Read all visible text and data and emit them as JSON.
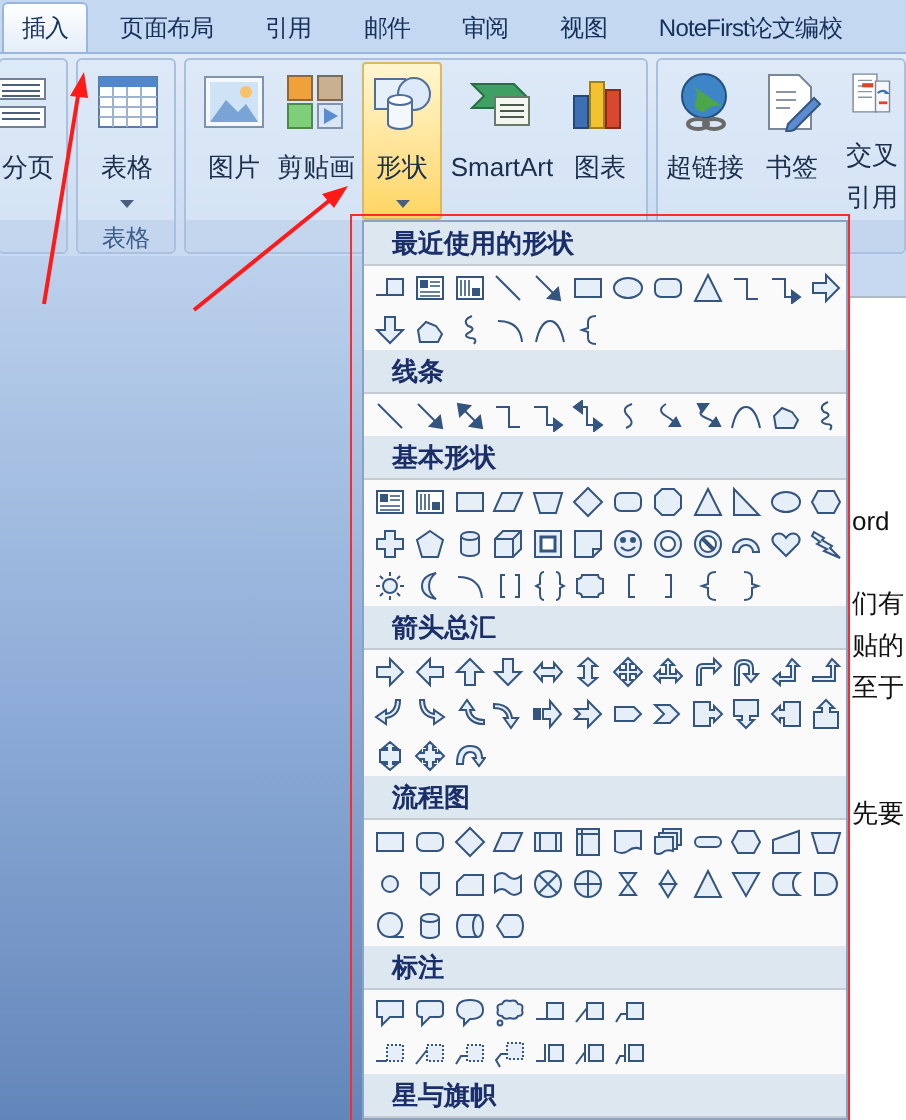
{
  "tabs": [
    {
      "label": "插入",
      "selected": true
    },
    {
      "label": "页面布局",
      "selected": false
    },
    {
      "label": "引用",
      "selected": false
    },
    {
      "label": "邮件",
      "selected": false
    },
    {
      "label": "审阅",
      "selected": false
    },
    {
      "label": "视图",
      "selected": false
    },
    {
      "label": "NoteFirst论文编校",
      "selected": false
    }
  ],
  "ribbon": {
    "groups": [
      {
        "buttons": [
          {
            "label": "分页",
            "kind": "page-break",
            "dropdown": false
          }
        ]
      },
      {
        "label": "表格",
        "buttons": [
          {
            "label": "表格",
            "kind": "table",
            "dropdown": true
          }
        ]
      },
      {
        "buttons": [
          {
            "label": "图片",
            "kind": "picture",
            "dropdown": false,
            "expanded": false
          },
          {
            "label": "剪贴画",
            "kind": "clip-art",
            "dropdown": false,
            "expanded": false
          },
          {
            "label": "形状",
            "kind": "shapes",
            "dropdown": true,
            "expanded": true
          },
          {
            "label": "SmartArt",
            "kind": "smartart",
            "dropdown": false,
            "expanded": false
          },
          {
            "label": "图表",
            "kind": "chart",
            "dropdown": false,
            "expanded": false
          }
        ]
      },
      {
        "buttons": [
          {
            "label": "超链接",
            "kind": "hyperlink",
            "dropdown": false
          },
          {
            "label": "书签",
            "kind": "bookmark",
            "dropdown": false
          },
          {
            "label": "交叉引用",
            "kind": "cross-reference",
            "dropdown": false
          }
        ]
      }
    ]
  },
  "shape_menu": {
    "sections": [
      {
        "title": "最近使用的形状",
        "rows": [
          [
            {
              "kind": "line-callout"
            },
            {
              "kind": "text-box"
            },
            {
              "kind": "vertical-text-box"
            },
            {
              "kind": "line"
            },
            {
              "kind": "arrow-line"
            },
            {
              "kind": "rect"
            },
            {
              "kind": "ellipse"
            },
            {
              "kind": "rounded-rect"
            },
            {
              "kind": "triangle"
            },
            {
              "kind": "elbow-line"
            },
            {
              "kind": "elbow-arrow"
            },
            {
              "kind": "right-arrow"
            }
          ],
          [
            {
              "kind": "down-arrow"
            },
            {
              "kind": "freeform"
            },
            {
              "kind": "scribble"
            },
            {
              "kind": "arc"
            },
            {
              "kind": "arch-curve"
            },
            {
              "kind": "left-brace"
            }
          ]
        ]
      },
      {
        "title": "线条",
        "rows": [
          [
            {
              "kind": "line"
            },
            {
              "kind": "arrow-line"
            },
            {
              "kind": "double-arrow-line"
            },
            {
              "kind": "elbow-line"
            },
            {
              "kind": "elbow-arrow"
            },
            {
              "kind": "elbow-double-arrow"
            },
            {
              "kind": "curved-line"
            },
            {
              "kind": "curved-arrow"
            },
            {
              "kind": "curved-double-arrow"
            },
            {
              "kind": "arch-curve"
            },
            {
              "kind": "freeform"
            },
            {
              "kind": "scribble"
            }
          ]
        ]
      },
      {
        "title": "基本形状",
        "rows": [
          [
            {
              "kind": "text-box"
            },
            {
              "kind": "vertical-text-box"
            },
            {
              "kind": "rect"
            },
            {
              "kind": "parallelogram"
            },
            {
              "kind": "trapezoid"
            },
            {
              "kind": "diamond"
            },
            {
              "kind": "rounded-rect"
            },
            {
              "kind": "octagon"
            },
            {
              "kind": "triangle"
            },
            {
              "kind": "right-triangle"
            },
            {
              "kind": "ellipse"
            },
            {
              "kind": "hexagon"
            }
          ],
          [
            {
              "kind": "cross"
            },
            {
              "kind": "pentagon"
            },
            {
              "kind": "cylinder"
            },
            {
              "kind": "cube"
            },
            {
              "kind": "frame"
            },
            {
              "kind": "folded-corner"
            },
            {
              "kind": "smiley"
            },
            {
              "kind": "donut"
            },
            {
              "kind": "no-symbol"
            },
            {
              "kind": "block-arc"
            },
            {
              "kind": "heart"
            },
            {
              "kind": "lightning"
            }
          ],
          [
            {
              "kind": "sun"
            },
            {
              "kind": "moon"
            },
            {
              "kind": "arc"
            },
            {
              "kind": "bracket-pair"
            },
            {
              "kind": "brace-pair"
            },
            {
              "kind": "plaque"
            },
            {
              "kind": "left-bracket"
            },
            {
              "kind": "right-bracket"
            },
            {
              "kind": "left-brace"
            },
            {
              "kind": "right-brace"
            }
          ]
        ]
      },
      {
        "title": "箭头总汇",
        "rows": [
          [
            {
              "kind": "right-arrow"
            },
            {
              "kind": "left-arrow"
            },
            {
              "kind": "up-arrow"
            },
            {
              "kind": "down-arrow"
            },
            {
              "kind": "left-right-arrow"
            },
            {
              "kind": "up-down-arrow"
            },
            {
              "kind": "quad-arrow"
            },
            {
              "kind": "three-way-arrow"
            },
            {
              "kind": "bent-arrow"
            },
            {
              "kind": "u-turn-arrow"
            },
            {
              "kind": "left-up-arrow"
            },
            {
              "kind": "bent-up-arrow"
            }
          ],
          [
            {
              "kind": "curved-right-arrow"
            },
            {
              "kind": "curved-left-arrow"
            },
            {
              "kind": "curved-up-arrow"
            },
            {
              "kind": "curved-down-arrow"
            },
            {
              "kind": "striped-arrow"
            },
            {
              "kind": "notched-arrow"
            },
            {
              "kind": "pentagon-arrow"
            },
            {
              "kind": "chevron"
            },
            {
              "kind": "right-arrow-callout"
            },
            {
              "kind": "down-arrow-callout"
            },
            {
              "kind": "left-arrow-callout"
            },
            {
              "kind": "up-arrow-callout"
            }
          ],
          [
            {
              "kind": "up-down-arrow-callout"
            },
            {
              "kind": "quad-arrow-callout"
            },
            {
              "kind": "circular-arrow"
            }
          ]
        ]
      },
      {
        "title": "流程图",
        "rows": [
          [
            {
              "kind": "rect"
            },
            {
              "kind": "rounded-rect"
            },
            {
              "kind": "diamond"
            },
            {
              "kind": "parallelogram"
            },
            {
              "kind": "double-side-rect"
            },
            {
              "kind": "corner-rect"
            },
            {
              "kind": "wavy-document"
            },
            {
              "kind": "stacked-documents"
            },
            {
              "kind": "stadium"
            },
            {
              "kind": "hexagon"
            },
            {
              "kind": "slanted-top-quad"
            },
            {
              "kind": "trapezoid"
            }
          ],
          [
            {
              "kind": "circle"
            },
            {
              "kind": "shield"
            },
            {
              "kind": "cut-corner-rect"
            },
            {
              "kind": "wavy-band"
            },
            {
              "kind": "x-circle"
            },
            {
              "kind": "plus-circle"
            },
            {
              "kind": "hourglass"
            },
            {
              "kind": "double-triangle"
            },
            {
              "kind": "triangle"
            },
            {
              "kind": "down-triangle"
            },
            {
              "kind": "stored-data"
            },
            {
              "kind": "half-round"
            }
          ],
          [
            {
              "kind": "tailed-circle"
            },
            {
              "kind": "cylinder"
            },
            {
              "kind": "horizontal-cylinder"
            },
            {
              "kind": "display-shape"
            }
          ]
        ]
      },
      {
        "title": "标注",
        "rows": [
          [
            {
              "kind": "rect-speech-bubble"
            },
            {
              "kind": "rounded-speech-bubble"
            },
            {
              "kind": "oval-speech-bubble"
            },
            {
              "kind": "cloud-bubble"
            },
            {
              "kind": "line-callout"
            },
            {
              "kind": "angled-line-callout"
            },
            {
              "kind": "bent-line-callout"
            }
          ],
          [
            {
              "kind": "dashed-line-callout"
            },
            {
              "kind": "dashed-angled-callout"
            },
            {
              "kind": "dashed-bent-callout"
            },
            {
              "kind": "dashed-double-bent-callout"
            },
            {
              "kind": "accent-line-callout"
            },
            {
              "kind": "accent-angled-callout"
            },
            {
              "kind": "accent-bent-callout"
            }
          ]
        ]
      },
      {
        "title": "星与旗帜"
      }
    ]
  },
  "document": {
    "fragments": [
      "ord",
      "们有",
      "贴的",
      "至于",
      "先要"
    ]
  }
}
